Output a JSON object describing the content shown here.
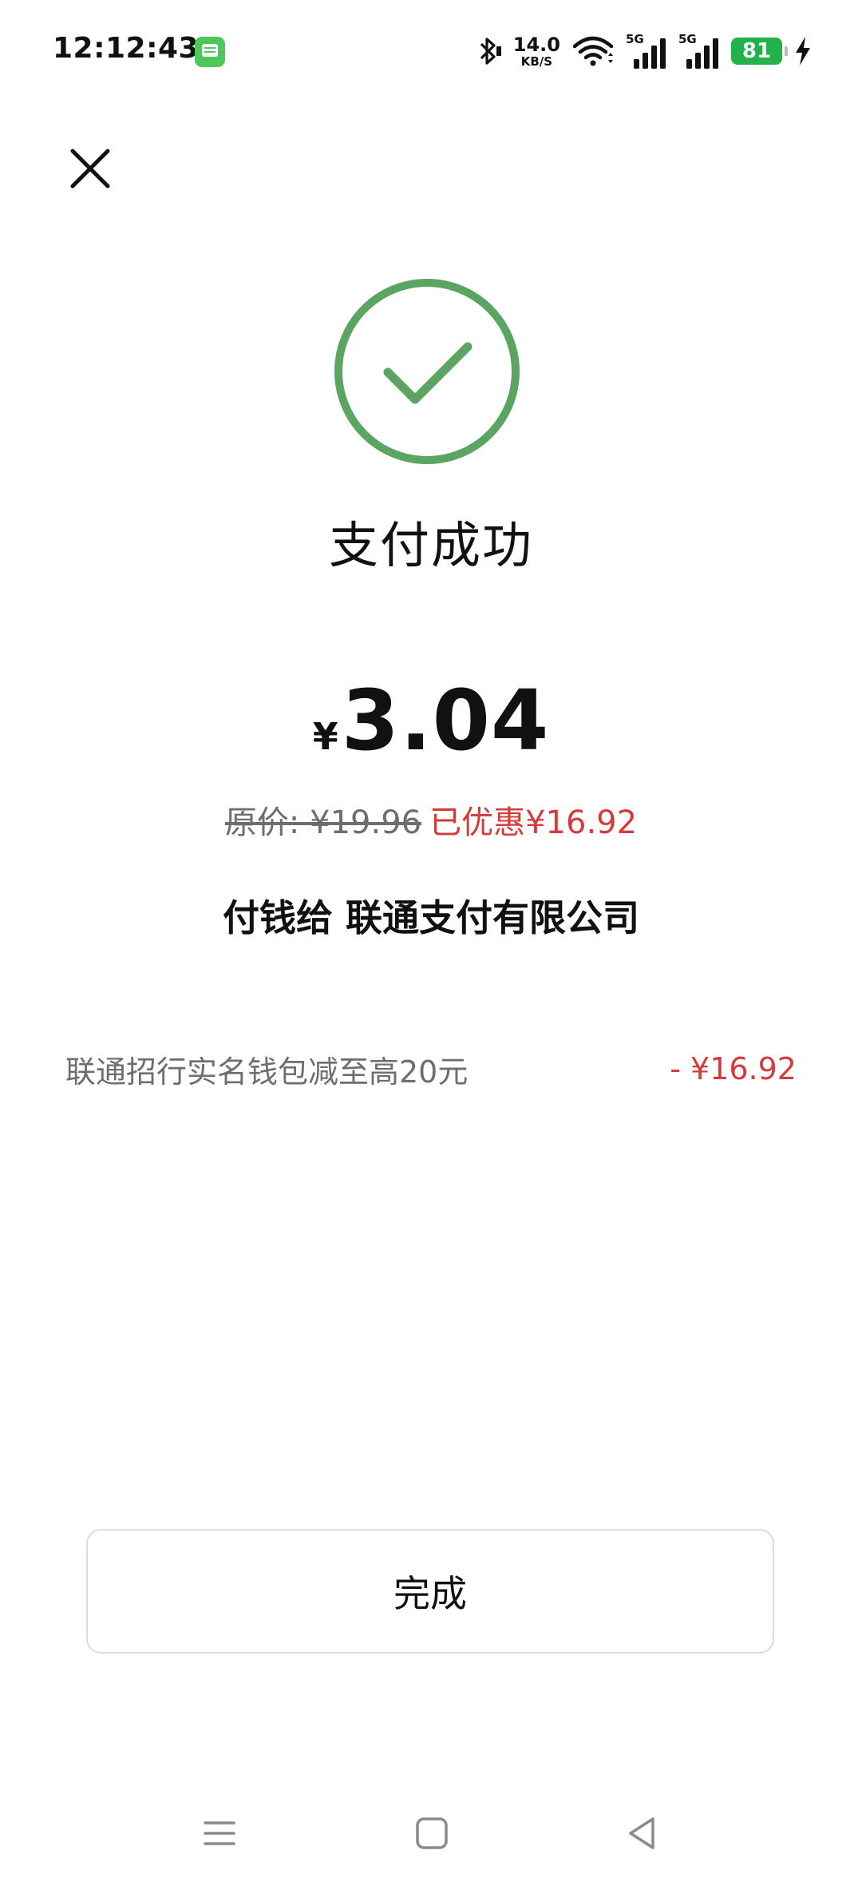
{
  "status_bar": {
    "time": "12:12:43",
    "net_speed_value": "14.0",
    "net_speed_unit": "KB/S",
    "sim1_label": "5G",
    "sim2_label": "5G",
    "battery_level": "81",
    "icons": [
      "message-app-icon",
      "bluetooth-icon",
      "wifi-icon",
      "signal-icon",
      "signal-icon",
      "battery-icon",
      "charging-icon"
    ]
  },
  "header": {
    "close_icon": "close-icon"
  },
  "result": {
    "icon": "check-circle-icon",
    "title": "支付成功",
    "accent_color": "#5aa561"
  },
  "payment": {
    "currency_symbol": "¥",
    "amount": "3.04",
    "original_price_text": "原价: ¥19.96",
    "discount_text": "已优惠¥16.92",
    "payee_text": "付钱给 联通支付有限公司"
  },
  "discounts": [
    {
      "label": "联通招行实名钱包减至高20元",
      "value": "- ¥16.92"
    }
  ],
  "colors": {
    "discount_red": "#d63b3b",
    "muted_gray": "#6e6e6e"
  },
  "actions": {
    "done_label": "完成"
  },
  "nav_bar": {
    "icons": [
      "menu-icon",
      "home-icon",
      "back-icon"
    ]
  }
}
